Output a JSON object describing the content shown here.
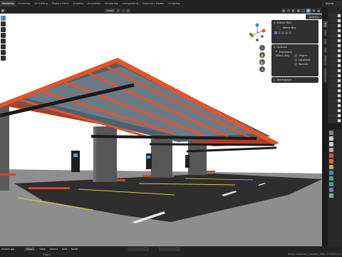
{
  "topbar": {
    "tabs": [
      "Modeling",
      "Sculpting",
      "UV Editing",
      "Texture Paint",
      "Shading",
      "Animation",
      "Rendering",
      "Compositing",
      "Geometry Nodes",
      "Scripting"
    ],
    "active_tab": "Modeling",
    "scene_label": "Scene"
  },
  "viewport_header": {
    "orientation_label": "Global",
    "options_label": "Options"
  },
  "active_tool_panel": {
    "title": "Active Tool",
    "tool_name": "Select Box"
  },
  "options_panel": {
    "title": "Options",
    "transform_label": "Transform",
    "affect_only_label": "Affect Only",
    "origins_label": "Origins",
    "locations_label": "Locations",
    "parents_label": "Parents"
  },
  "workspace_panel": {
    "title": "Workspace"
  },
  "npanel_tabs": [
    "Tool",
    "View",
    "Edit",
    "Tool",
    "Material",
    "Screencast"
  ],
  "footer": {
    "filename": "ement.jpg",
    "mode_label": "Object",
    "menu_view": "View",
    "menu_select": "Select",
    "menu_add": "Add",
    "menu_node": "Node",
    "status_left": "Object",
    "stats": "Scene Collection | Camera | Verts 373,632 | Fa"
  },
  "colors": {
    "accent": "#5680c2",
    "canopy_orange": "#e4532a",
    "panel_bg": "#1e1e1e"
  }
}
